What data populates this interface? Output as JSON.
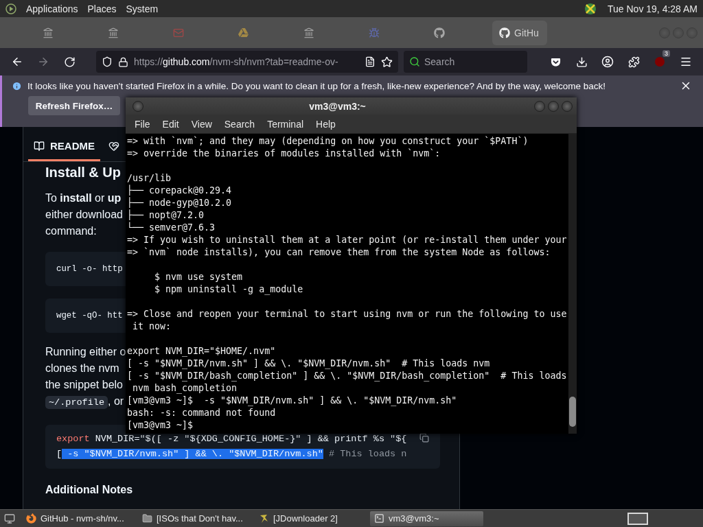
{
  "top_panel": {
    "menus": [
      "Applications",
      "Places",
      "System"
    ],
    "clock": "Tue Nov 19, 4:28 AM"
  },
  "browser": {
    "tabs": [
      {
        "kind": "archive",
        "selected": false
      },
      {
        "kind": "archive",
        "selected": false
      },
      {
        "kind": "mail",
        "selected": false
      },
      {
        "kind": "drive",
        "selected": false
      },
      {
        "kind": "archive",
        "selected": false
      },
      {
        "kind": "bug",
        "selected": false
      },
      {
        "kind": "github",
        "selected": false
      },
      {
        "kind": "github",
        "selected": true,
        "label": "GitHu"
      }
    ],
    "url": {
      "scheme": "https://",
      "host": "github.com",
      "path": "/nvm-sh/nvm?tab=readme-ov-"
    },
    "search": {
      "placeholder": "Search"
    },
    "extension_badge": "3",
    "notification": {
      "message": "It looks like you haven't started Firefox in a while. Do you want to clean it up for a fresh, like-new experience? And by the way, welcome back!",
      "button": "Refresh Firefox…"
    }
  },
  "readme": {
    "tabs": [
      {
        "label": "README",
        "selected": true
      },
      {
        "selected": false
      }
    ],
    "content": [
      {
        "kind": "heading",
        "text": "Install & Up"
      },
      {
        "kind": "line",
        "text": "To **install** or **up**"
      },
      {
        "kind": "line",
        "text": "either download"
      },
      {
        "kind": "line",
        "text": "command:"
      },
      {
        "kind": "code",
        "text": "curl -o- http"
      },
      {
        "kind": "code",
        "text": "wget -qO- htt"
      },
      {
        "kind": "line",
        "text": "Running either o"
      },
      {
        "kind": "line",
        "text": "clones the nvm"
      },
      {
        "kind": "line",
        "text": "the snippet belo"
      },
      {
        "kind": "chip_line",
        "code": "~/.profile",
        "text": ", or"
      },
      {
        "kind": "codeblock",
        "lines": [
          [
            {
              "kind": "keyword",
              "text": "export",
              "selected": false
            },
            {
              "kind": "plain",
              "text": " NVM_DIR=\"$([ -z \"${XDG_CONFIG_HOME-}\" ] && printf %s \"${",
              "selected": false
            }
          ],
          [
            {
              "kind": "plain",
              "text": "[",
              "selected": false
            },
            {
              "kind": "plain",
              "text": " -s \"$NVM_DIR/nvm.sh\" ] && \\. \"$NVM_DIR/nvm.sh\"",
              "selected": true
            },
            {
              "kind": "comment",
              "text": " # This loads n",
              "selected": false
            }
          ]
        ]
      },
      {
        "kind": "subheading",
        "text": "Additional Notes"
      }
    ]
  },
  "terminal": {
    "title": "vm3@vm3:~",
    "menus": [
      "File",
      "Edit",
      "View",
      "Search",
      "Terminal",
      "Help"
    ],
    "lines": [
      {
        "kind": "text",
        "text": "=> with `nvm`; and they may (depending on how you construct your `$PATH`)"
      },
      {
        "kind": "text",
        "text": "=> override the binaries of modules installed with `nvm`:"
      },
      {
        "kind": "blank"
      },
      {
        "kind": "text",
        "text": "/usr/lib"
      },
      {
        "kind": "text",
        "text": "├── corepack@0.29.4"
      },
      {
        "kind": "text",
        "text": "├── node-gyp@10.2.0"
      },
      {
        "kind": "text",
        "text": "├── nopt@7.2.0"
      },
      {
        "kind": "text",
        "text": "└── semver@7.6.3"
      },
      {
        "kind": "text",
        "text": "=> If you wish to uninstall them at a later point (or re-install them under your"
      },
      {
        "kind": "text",
        "text": "=> `nvm` node installs), you can remove them from the system Node as follows:"
      },
      {
        "kind": "blank"
      },
      {
        "kind": "text",
        "text": "     $ nvm use system"
      },
      {
        "kind": "text",
        "text": "     $ npm uninstall -g a_module"
      },
      {
        "kind": "blank"
      },
      {
        "kind": "text",
        "text": "=> Close and reopen your terminal to start using nvm or run the following to use"
      },
      {
        "kind": "text",
        "text": " it now:"
      },
      {
        "kind": "blank"
      },
      {
        "kind": "text",
        "text": "export NVM_DIR=\"$HOME/.nvm\""
      },
      {
        "kind": "text",
        "text": "[ -s \"$NVM_DIR/nvm.sh\" ] && \\. \"$NVM_DIR/nvm.sh\"  # This loads nvm"
      },
      {
        "kind": "text",
        "text": "[ -s \"$NVM_DIR/bash_completion\" ] && \\. \"$NVM_DIR/bash_completion\"  # This loads"
      },
      {
        "kind": "text",
        "text": " nvm bash_completion"
      },
      {
        "kind": "text",
        "text": "[vm3@vm3 ~]$  -s \"$NVM_DIR/nvm.sh\" ] && \\. \"$NVM_DIR/nvm.sh\""
      },
      {
        "kind": "text",
        "text": "bash: -s: command not found"
      },
      {
        "kind": "text",
        "text": "[vm3@vm3 ~]$"
      }
    ]
  },
  "taskbar": {
    "items": [
      {
        "kind": "firefox",
        "label": "GitHub - nvm-sh/nv...",
        "selected": false
      },
      {
        "kind": "folder",
        "label": "[ISOs that Don't hav...",
        "selected": false
      },
      {
        "kind": "downloader",
        "label": "[JDownloader 2]",
        "selected": false
      },
      {
        "kind": "terminal",
        "label": "vm3@vm3:~",
        "selected": true
      }
    ]
  }
}
